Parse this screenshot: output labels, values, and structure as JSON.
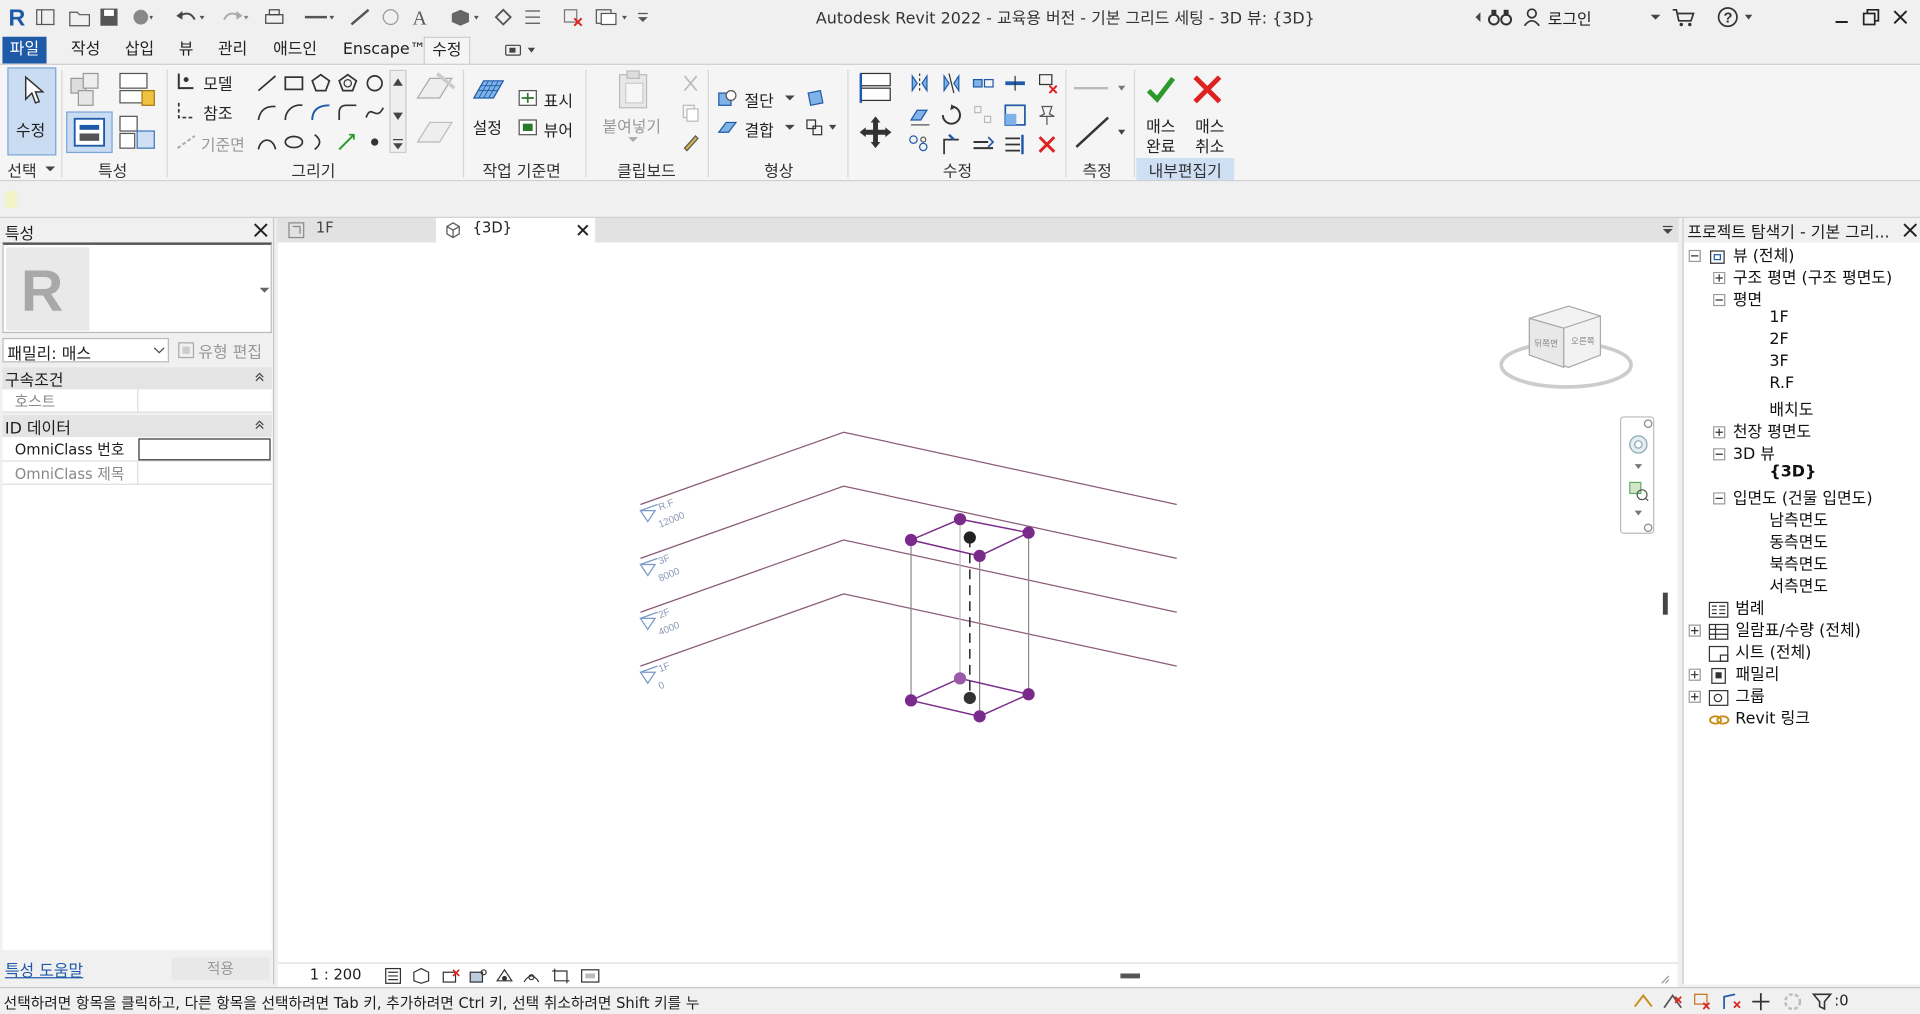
{
  "title_bar": {
    "title": "Autodesk Revit 2022 - 교육용 버전 - 기본 그리드 세팅 - 3D 뷰: {3D}",
    "login_label": "로그인"
  },
  "ribbon_tabs": [
    "파일",
    "작성",
    "삽입",
    "뷰",
    "관리",
    "애드인",
    "Enscape™",
    "수정"
  ],
  "ribbon": {
    "select_panel": {
      "modify_label": "수정",
      "panel_label": "선택"
    },
    "props_panel": {
      "panel_label": "특성"
    },
    "draw_panel": {
      "model_label": "모델",
      "ref_label": "참조",
      "plane_label": "기준면",
      "panel_label": "그리기"
    },
    "workplane_panel": {
      "set_label": "설정",
      "show_label": "표시",
      "viewer_label": "뷰어",
      "panel_label": "작업 기준면"
    },
    "clipboard_panel": {
      "paste_label": "붙여넣기",
      "panel_label": "클립보드"
    },
    "geometry_panel": {
      "cut_label": "절단",
      "join_label": "결합",
      "panel_label": "형상"
    },
    "modify_panel": {
      "panel_label": "수정"
    },
    "measure_panel": {
      "panel_label": "측정"
    },
    "inplace_panel": {
      "finish_label_1": "매스",
      "finish_label_2": "완료",
      "cancel_label_1": "매스",
      "cancel_label_2": "취소",
      "panel_label": "내부편집기"
    }
  },
  "properties": {
    "title": "특성",
    "family_label": "패밀리: 매스",
    "edit_type_label": "유형 편집",
    "section1": "구속조건",
    "host_label": "호스트",
    "section2": "ID 데이터",
    "omniclass_num_label": "OmniClass 번호",
    "omniclass_title_label": "OmniClass 제목",
    "help_link": "특성 도움말",
    "apply_label": "적용"
  },
  "view_tabs": [
    {
      "label": "1F"
    },
    {
      "label": "{3D}"
    }
  ],
  "viewport": {
    "scale": "1 : 200",
    "viewcube_left": "뒤쪽면",
    "viewcube_right": "오른쪽",
    "levels": [
      {
        "name": "R.F",
        "elev": "12000"
      },
      {
        "name": "3F",
        "elev": "8000"
      },
      {
        "name": "2F",
        "elev": "4000"
      },
      {
        "name": "1F",
        "elev": "0"
      }
    ]
  },
  "browser": {
    "title": "프로젝트 탐색기 - 기본 그리...",
    "items": [
      {
        "label": "뷰 (전체)"
      },
      {
        "label": "구조 평면 (구조 평면도)"
      },
      {
        "label": "평면"
      },
      {
        "label": "1F"
      },
      {
        "label": "2F"
      },
      {
        "label": "3F"
      },
      {
        "label": "R.F"
      },
      {
        "label": "배치도"
      },
      {
        "label": "천장 평면도"
      },
      {
        "label": "3D 뷰"
      },
      {
        "label": "{3D}"
      },
      {
        "label": "입면도 (건물 입면도)"
      },
      {
        "label": "남측면도"
      },
      {
        "label": "동측면도"
      },
      {
        "label": "북측면도"
      },
      {
        "label": "서측면도"
      },
      {
        "label": "범례"
      },
      {
        "label": "일람표/수량 (전체)"
      },
      {
        "label": "시트 (전체)"
      },
      {
        "label": "패밀리"
      },
      {
        "label": "그룹"
      },
      {
        "label": "Revit 링크"
      }
    ]
  },
  "status": {
    "message": "선택하려면 항목을 클릭하고, 다른 항목을 선택하려면 Tab 키, 추가하려면 Ctrl 키, 선택 취소하려면 Shift 키를 누",
    "filter_count": ":0"
  },
  "colors": {
    "accent": "#1e5aa8",
    "mass": "#7a2a8a",
    "level_line": "#8a5a78"
  }
}
